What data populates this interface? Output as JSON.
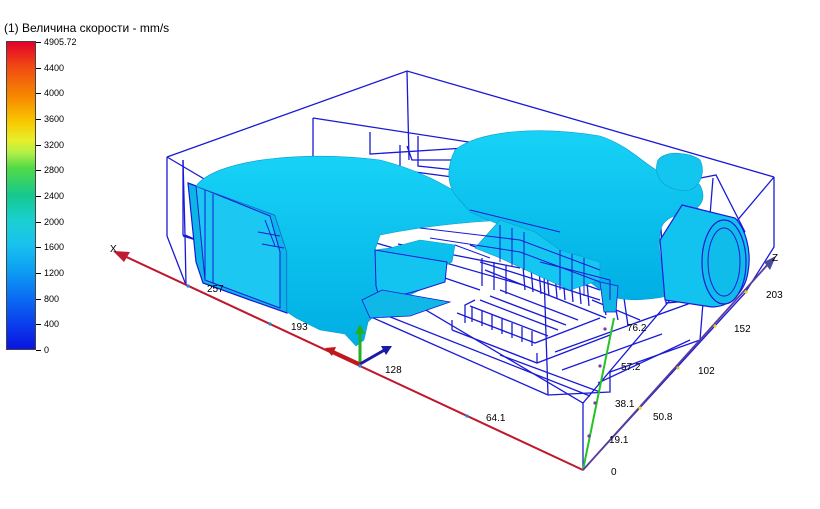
{
  "legend": {
    "title": "(1) Величина скорости - mm/s",
    "labels": [
      "4905.72",
      "4400",
      "4000",
      "3600",
      "3200",
      "2800",
      "2400",
      "2000",
      "1600",
      "1200",
      "800",
      "400",
      "0"
    ]
  },
  "axes": {
    "x_letter": "X",
    "z_letter": "Z",
    "x_ticks": [
      "257",
      "193",
      "128",
      "64.1"
    ],
    "y_ticks": [
      "76.2",
      "57.2",
      "38.1",
      "19.1",
      "0"
    ],
    "z_ticks": [
      "203",
      "152",
      "102",
      "50.8"
    ],
    "colors": {
      "x_axis": "#c0182e",
      "y_axis": "#22c522",
      "z_axis": "#4a4a9a"
    }
  },
  "scene": {
    "wireframe_color": "#1a1ad6",
    "flow_surface_color": "#0fc4ef"
  }
}
